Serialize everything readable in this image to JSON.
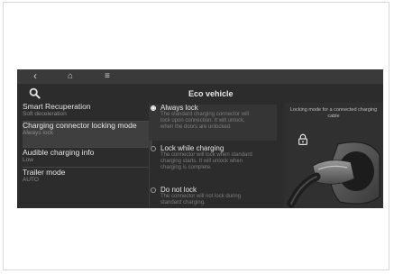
{
  "topbar": {
    "back_icon": "chevron-left-icon",
    "home_icon": "home-icon",
    "menu_icon": "menu-icon",
    "back_glyph": "‹",
    "home_glyph": "⌂",
    "menu_glyph": "≡"
  },
  "header": {
    "title": "Eco vehicle",
    "search_icon": "search-icon"
  },
  "sidebar": {
    "items": [
      {
        "label": "Smart Recuperation",
        "value": "Soft deceleration"
      },
      {
        "label": "Charging connector locking mode",
        "value": "Always lock"
      },
      {
        "label": "Audible charging info",
        "value": "Low"
      },
      {
        "label": "Trailer mode",
        "value": "AUTO"
      }
    ],
    "selected_index": 1
  },
  "options": {
    "items": [
      {
        "label": "Always lock",
        "description": "The standard charging connector will lock upon connection. It will unlock, when the doors are unlocked.",
        "checked": true
      },
      {
        "label": "Lock while charging",
        "description": "The connector will lock when standard charging starts. It will unlock when charging is complete.",
        "checked": false
      },
      {
        "label": "Do not lock",
        "description": "The connector will not lock during standard charging.",
        "checked": false
      }
    ]
  },
  "preview": {
    "title": "Locking mode for a connected charging cable",
    "lock_icon": "lock-icon",
    "image": "charging-plug-image"
  },
  "colors": {
    "screen_bg": "#2c2c2c",
    "topbar_bg": "#3a3a3a",
    "text_primary": "#e6e6e6",
    "text_secondary": "#8c8c8c"
  }
}
